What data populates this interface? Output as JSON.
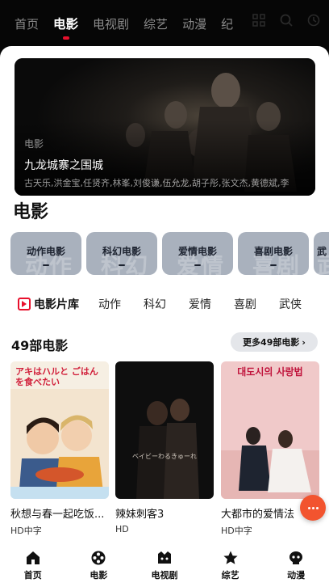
{
  "top_nav": {
    "tabs": [
      "首页",
      "电影",
      "电视剧",
      "综艺",
      "动漫",
      "纪"
    ],
    "active_tab": "电影",
    "accent_color": "#e8102c"
  },
  "banner": {
    "tag": "电影",
    "title": "九龙城寨之围城",
    "cast": "古天乐,洪金宝,任贤齐,林峯,刘俊谦,伍允龙,胡子彤,张文杰,黄德斌,李"
  },
  "section": {
    "title": "电影"
  },
  "genres": [
    {
      "label": "动作电影",
      "bg": "动作"
    },
    {
      "label": "科幻电影",
      "bg": "科幻"
    },
    {
      "label": "爱情电影",
      "bg": "爱情"
    },
    {
      "label": "喜剧电影",
      "bg": "喜剧"
    },
    {
      "label": "武",
      "bg": "武"
    }
  ],
  "categories": {
    "library_label": "电影片库",
    "items": [
      "动作",
      "科幻",
      "爱情",
      "喜剧",
      "武侠"
    ]
  },
  "movies": {
    "count_label": "49部电影",
    "more_label": "更多49部电影",
    "items": [
      {
        "title": "秋想与春一起吃饭...",
        "badge": "HD中字",
        "poster_text": "アキはハルと ごはんを食べたい"
      },
      {
        "title": "辣妹刺客3",
        "badge": "HD",
        "poster_text": "ベイビーわるきゅーれ"
      },
      {
        "title": "大都市的爱情法",
        "badge": "HD中字",
        "poster_text": "대도시의 사랑법"
      }
    ]
  },
  "fab": {
    "icon": "more-dots-icon",
    "color": "#f2542f"
  },
  "bottom_nav": [
    {
      "label": "首页",
      "icon": "home-icon"
    },
    {
      "label": "电影",
      "icon": "film-reel-icon"
    },
    {
      "label": "电视剧",
      "icon": "tv-icon"
    },
    {
      "label": "综艺",
      "icon": "star-icon"
    },
    {
      "label": "动漫",
      "icon": "anime-face-icon"
    }
  ]
}
